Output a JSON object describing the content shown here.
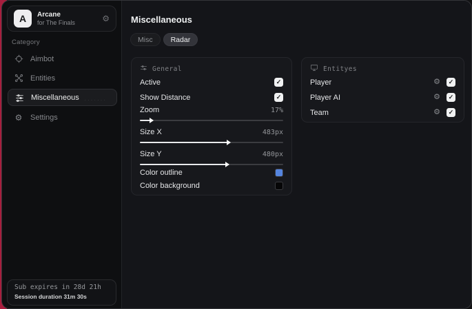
{
  "app": {
    "logo_letter": "A",
    "name": "Arcane",
    "subtitle": "for The Finals",
    "gear_glyph": "⚙"
  },
  "sidebar": {
    "category_label": "Category",
    "items": [
      {
        "label": "Aimbot"
      },
      {
        "label": "Entities"
      },
      {
        "label": "Miscellaneous"
      },
      {
        "label": "Settings"
      }
    ],
    "footer": {
      "line1": "Sub expires in 28d 21h",
      "line2": "Session duration 31m 30s"
    }
  },
  "main": {
    "title": "Miscellaneous",
    "tabs": [
      {
        "label": "Misc",
        "active": false
      },
      {
        "label": "Radar",
        "active": true
      }
    ],
    "general": {
      "title": "General",
      "toggles": [
        {
          "label": "Active",
          "checked": true,
          "check_glyph": "✓"
        },
        {
          "label": "Show Distance",
          "checked": true,
          "check_glyph": "✓"
        }
      ],
      "sliders": [
        {
          "label": "Zoom",
          "value": "17%",
          "percent": 7
        },
        {
          "label": "Size X",
          "value": "483px",
          "percent": 61
        },
        {
          "label": "Size Y",
          "value": "480px",
          "percent": 60
        }
      ],
      "colors": [
        {
          "label": "Color outline",
          "color": "#5585e0"
        },
        {
          "label": "Color background",
          "color": "#060607"
        }
      ]
    },
    "entities": {
      "title": "Entityes",
      "rows": [
        {
          "label": "Player",
          "checked": true,
          "check_glyph": "✓",
          "gear_glyph": "⚙"
        },
        {
          "label": "Player AI",
          "checked": true,
          "check_glyph": "✓",
          "gear_glyph": "⚙"
        },
        {
          "label": "Team",
          "checked": true,
          "check_glyph": "✓",
          "gear_glyph": "⚙"
        }
      ]
    }
  },
  "colors": {
    "accent_blue": "#5585e0",
    "backdrop_red": "#a81e3e"
  }
}
